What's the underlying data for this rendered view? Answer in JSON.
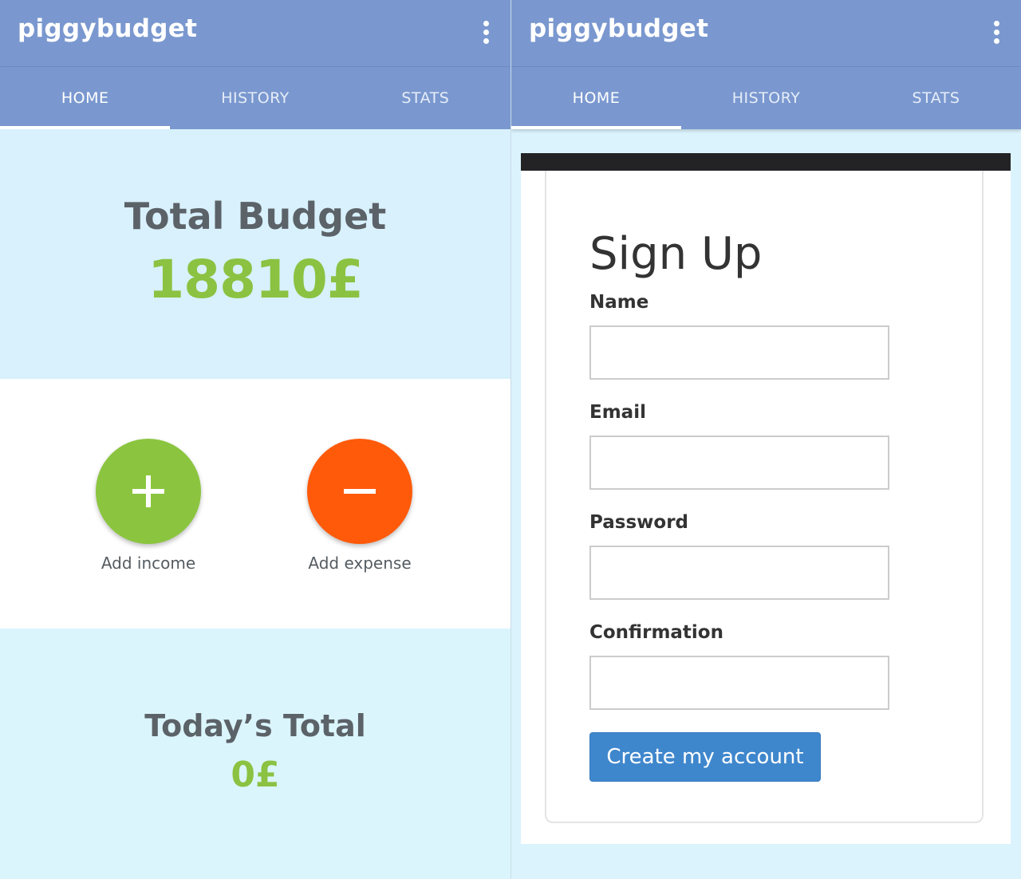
{
  "app": {
    "title": "piggybudget"
  },
  "tabs": [
    {
      "label": "HOME",
      "active": true
    },
    {
      "label": "HISTORY",
      "active": false
    },
    {
      "label": "STATS",
      "active": false
    }
  ],
  "home": {
    "total_budget_label": "Total Budget",
    "total_budget_value": "18810£",
    "add_income_label": "Add income",
    "add_expense_label": "Add expense",
    "todays_total_label": "Today’s Total",
    "todays_total_value": "0£"
  },
  "signup": {
    "title": "Sign Up",
    "fields": [
      {
        "label": "Name",
        "value": ""
      },
      {
        "label": "Email",
        "value": ""
      },
      {
        "label": "Password",
        "value": ""
      },
      {
        "label": "Confirmation",
        "value": ""
      }
    ],
    "submit_label": "Create my account"
  },
  "colors": {
    "appbar": "#7a98cf",
    "budget_green": "#8bc242",
    "income_green": "#8bc53f",
    "expense_orange": "#ff5a0a",
    "submit_blue": "#3f87cd"
  },
  "icons": [
    "more-vert-icon",
    "plus-icon",
    "minus-icon"
  ]
}
